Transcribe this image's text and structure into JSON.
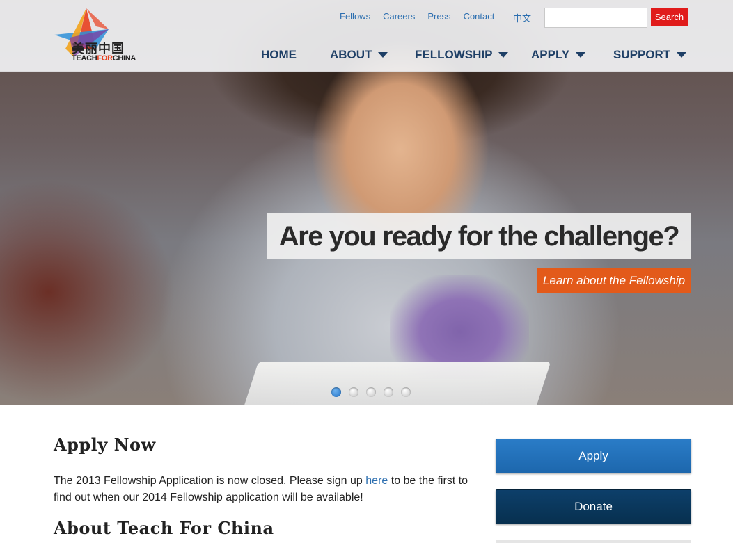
{
  "header": {
    "logo": {
      "cn_text": "美丽中国",
      "en_text_teach": "TEACH",
      "en_text_for": "FOR",
      "en_text_china": "CHINA",
      "icon": "star-logo-icon"
    },
    "util_nav": [
      "Fellows",
      "Careers",
      "Press",
      "Contact"
    ],
    "lang_switch": "中文",
    "search": {
      "value": "",
      "placeholder": "",
      "button_label": "Search"
    },
    "main_nav": [
      {
        "label": "HOME",
        "has_dropdown": false
      },
      {
        "label": "ABOUT",
        "has_dropdown": true
      },
      {
        "label": "FELLOWSHIP",
        "has_dropdown": true
      },
      {
        "label": "APPLY",
        "has_dropdown": true
      },
      {
        "label": "SUPPORT",
        "has_dropdown": true
      }
    ]
  },
  "hero": {
    "headline": "Are you ready for the challenge?",
    "cta_label": "Learn about the Fellowship",
    "slide_count": 5,
    "active_slide": 1
  },
  "content": {
    "apply_heading": "Apply Now",
    "apply_text_before_link": "The 2013 Fellowship Application is now closed.  Please sign up ",
    "apply_link_text": "here",
    "apply_text_after_link": " to be the first to find out when our 2014 Fellowship application will be available!",
    "about_heading": "About Teach For China"
  },
  "sidebar": {
    "apply_button": "Apply",
    "donate_button": "Donate"
  },
  "colors": {
    "brand_red": "#e01b1b",
    "nav_blue": "#1e3f66",
    "link_blue": "#2d6fb0",
    "cta_orange": "#e35a1a",
    "apply_blue": "#1d67ad",
    "donate_navy": "#07304f"
  }
}
